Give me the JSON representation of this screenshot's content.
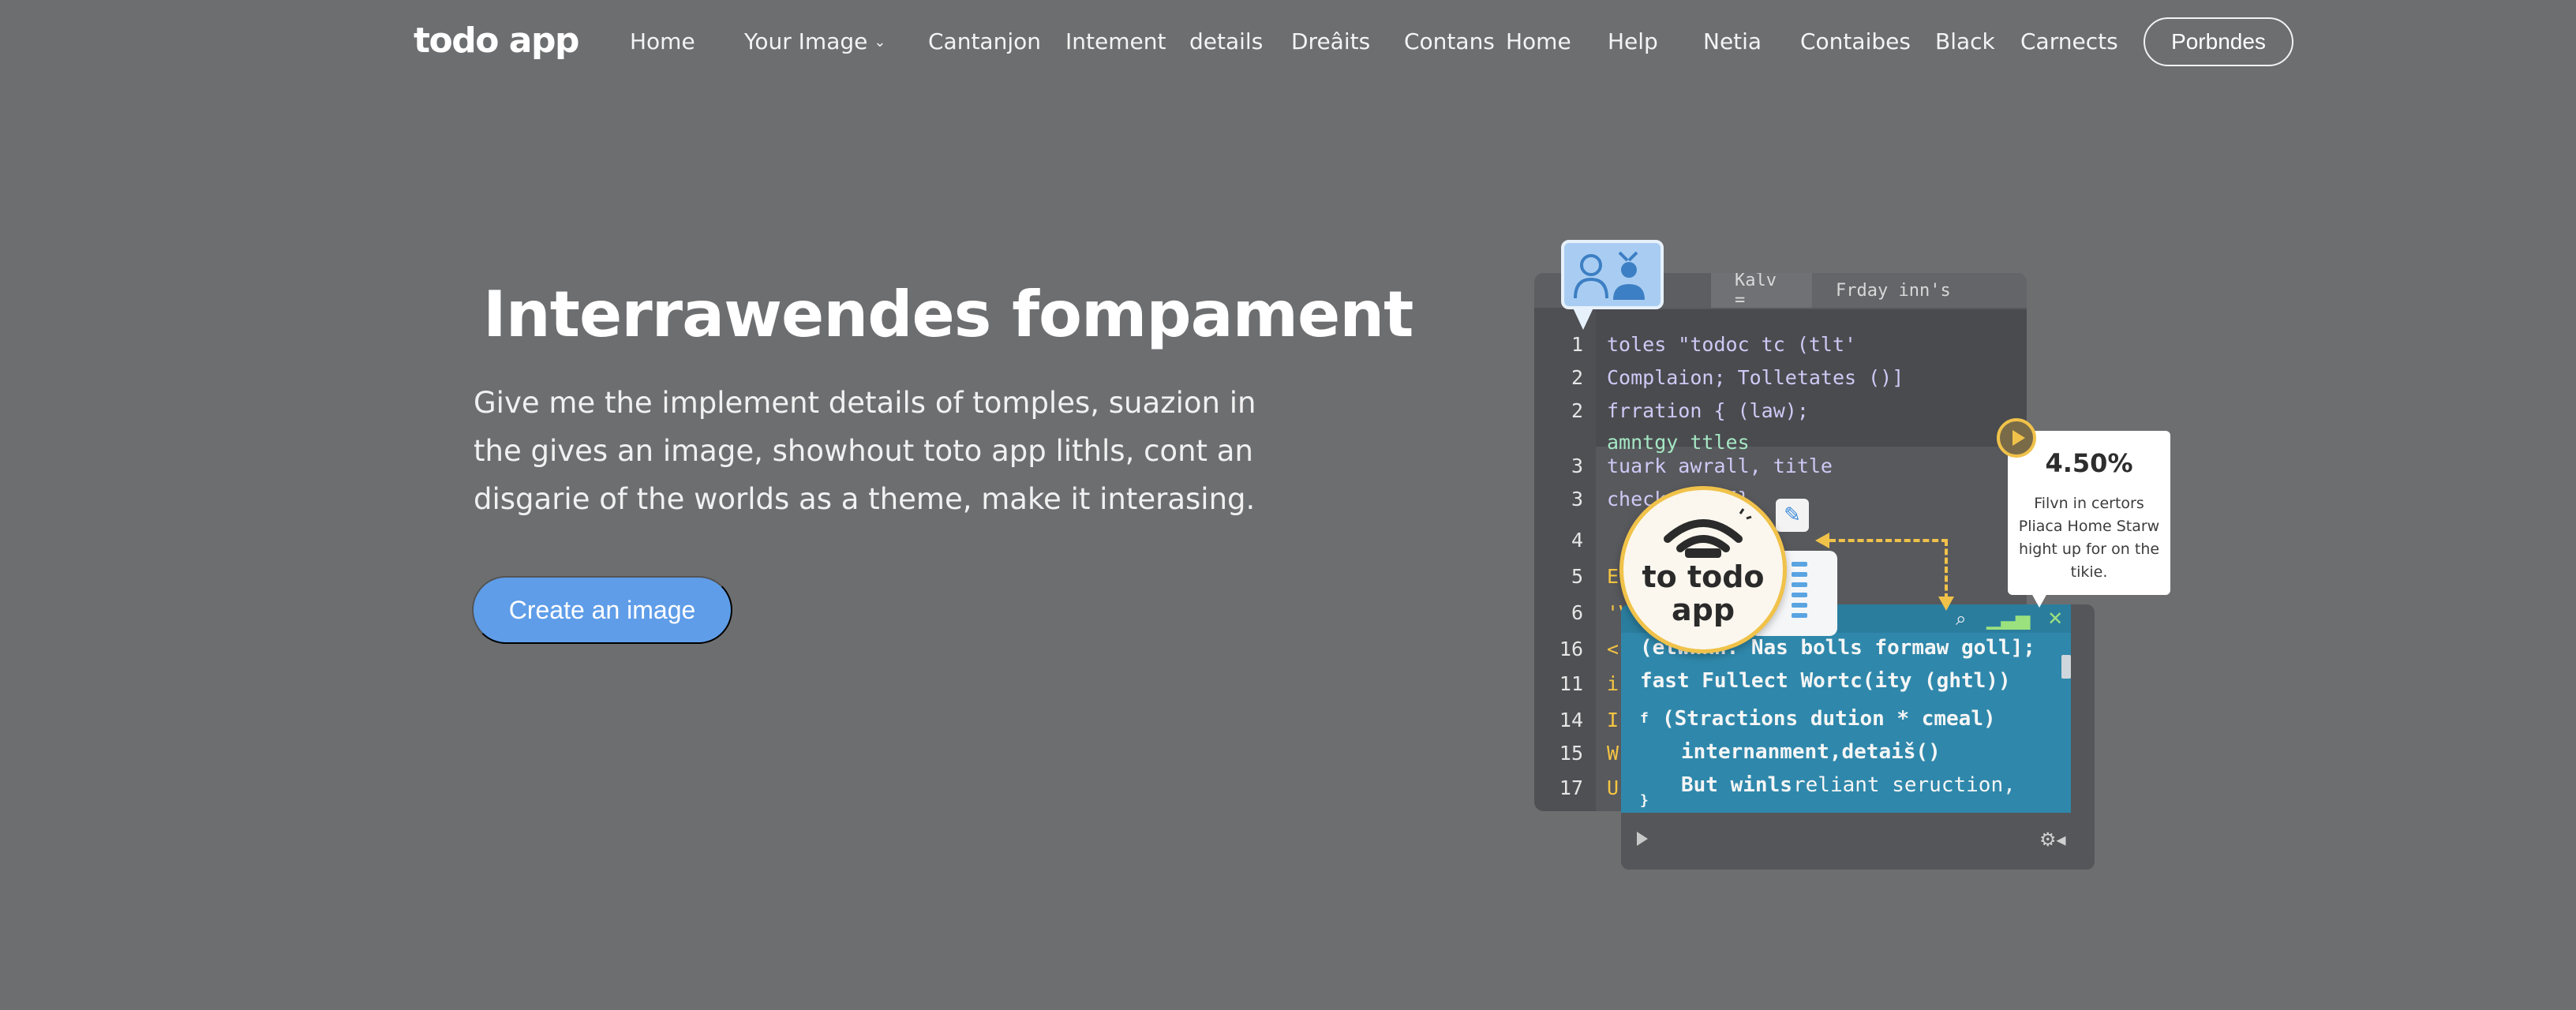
{
  "nav": {
    "logo": "todo app",
    "items": [
      {
        "label": "Home"
      },
      {
        "label": "Your Image"
      },
      {
        "label": "Cantanjon"
      },
      {
        "label": "Intement"
      },
      {
        "label": "details"
      },
      {
        "label": "Dreâits"
      },
      {
        "label": "Contans"
      },
      {
        "label": "Home"
      },
      {
        "label": "Help"
      },
      {
        "label": "Netia"
      },
      {
        "label": "Contaibes"
      },
      {
        "label": "Black"
      },
      {
        "label": "Carnects"
      }
    ],
    "cta": "Porbndes"
  },
  "hero": {
    "title": "Interrawendes fompament",
    "description": "Give me the implement details of tomples, suazion in the gives an image, showhout toto app lithls, cont an disgarie of the worlds as a theme, make it interasing.",
    "cta": "Create an image"
  },
  "editor": {
    "tabs": [
      "Kalv =",
      "Frday inn's"
    ],
    "lines": [
      {
        "num": "1",
        "text": "toles \"todoc tc (tlt'"
      },
      {
        "num": "2",
        "text": "Complaion; Tolletates ()]"
      },
      {
        "num": "2",
        "text": "frration { (law);"
      },
      {
        "num": "",
        "text": "amntgy ttles"
      },
      {
        "num": "3",
        "text": "tuark awrall, title"
      },
      {
        "num": "3",
        "text": "check  ... {}"
      },
      {
        "num": "4",
        "text": ""
      },
      {
        "num": "5",
        "text": "E"
      },
      {
        "num": "6",
        "text": "'V"
      },
      {
        "num": "16",
        "text": "<"
      },
      {
        "num": "11",
        "text": "i"
      },
      {
        "num": "14",
        "text": "I"
      },
      {
        "num": "15",
        "text": "W"
      },
      {
        "num": "17",
        "text": "U"
      }
    ]
  },
  "panel": {
    "lines": [
      "(etwnkh: Nas bolls formaw goll];",
      "fast Fullect Wortc(ity (ghtl))",
      "(Stractions dution * cmeal)",
      "internanment,detaiš()",
      "But winls",
      "reliant seruction,"
    ],
    "bullets": [
      "f",
      "}"
    ]
  },
  "badge": {
    "text": "to todo app"
  },
  "stat": {
    "value": "4.50%",
    "description": "Filvn in certors Pliaca Home Starw hight up for on the tikie."
  },
  "colors": {
    "background": "#6d6e70",
    "accent": "#5f9de8",
    "highlight": "#f0c24a",
    "panel": "#2f88ab"
  }
}
